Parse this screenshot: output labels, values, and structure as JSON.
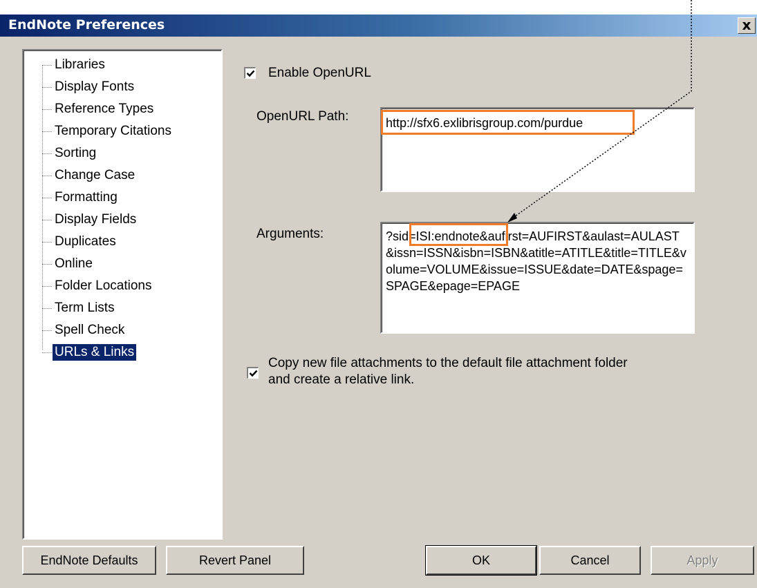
{
  "window": {
    "title": "EndNote Preferences",
    "close_glyph": "x"
  },
  "tree": {
    "items": [
      {
        "label": "Libraries",
        "selected": false
      },
      {
        "label": "Display Fonts",
        "selected": false
      },
      {
        "label": "Reference Types",
        "selected": false
      },
      {
        "label": "Temporary Citations",
        "selected": false
      },
      {
        "label": "Sorting",
        "selected": false
      },
      {
        "label": "Change Case",
        "selected": false
      },
      {
        "label": "Formatting",
        "selected": false
      },
      {
        "label": "Display Fields",
        "selected": false
      },
      {
        "label": "Duplicates",
        "selected": false
      },
      {
        "label": "Online",
        "selected": false
      },
      {
        "label": "Folder Locations",
        "selected": false
      },
      {
        "label": "Term Lists",
        "selected": false
      },
      {
        "label": "Spell Check",
        "selected": false
      },
      {
        "label": "URLs & Links",
        "selected": true
      }
    ]
  },
  "openurl": {
    "enable_label": "Enable OpenURL",
    "enabled": true,
    "path_label": "OpenURL Path:",
    "path_value": "http://sfx6.exlibrisgroup.com/purdue",
    "arguments_label": "Arguments:",
    "arguments_value": "?sid=ISI:endnote&aufirst=AUFIRST&aulast=AULAST&issn=ISSN&isbn=ISBN&atitle=ATITLE&title=TITLE&volume=VOLUME&issue=ISSUE&date=DATE&spage=SPAGE&epage=EPAGE"
  },
  "attachments": {
    "copy_label_line1": "Copy new file attachments to the default file attachment folder",
    "copy_label_line2": "and create a relative link.",
    "checked": true
  },
  "buttons": {
    "defaults": "EndNote Defaults",
    "revert": "Revert Panel",
    "ok": "OK",
    "cancel": "Cancel",
    "apply": "Apply"
  },
  "colors": {
    "highlight": "#f07c2a",
    "selection": "#0a246a",
    "dialog_bg": "#d4d0c8"
  }
}
